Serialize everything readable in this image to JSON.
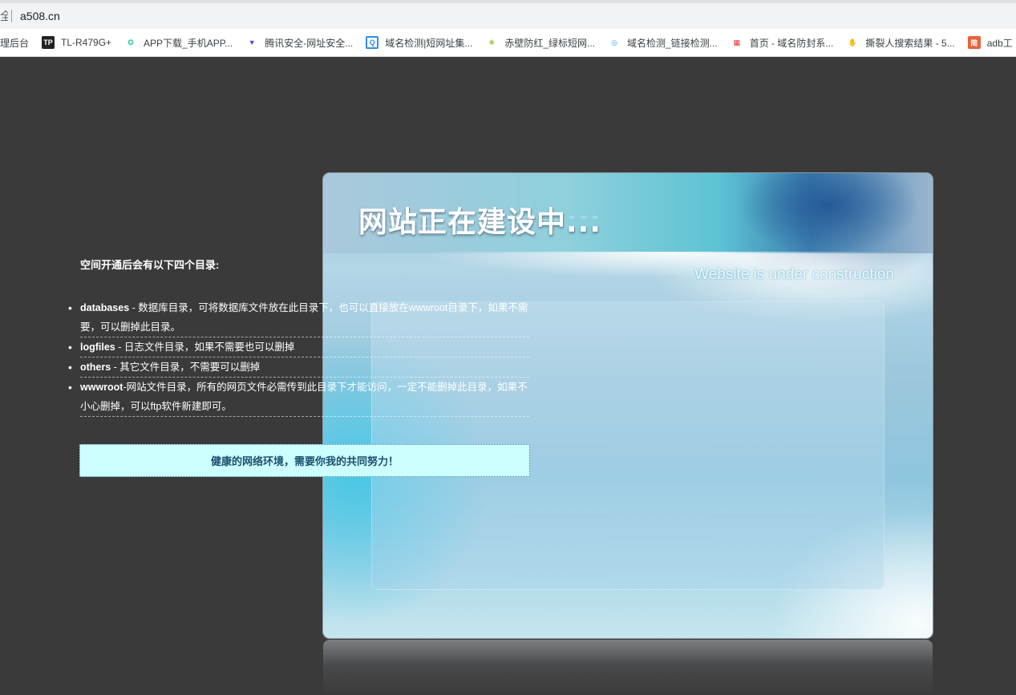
{
  "browser": {
    "address_prefix": "全",
    "url": "a508.cn"
  },
  "bookmarks": [
    {
      "label": "理后台",
      "icon": "none"
    },
    {
      "label": "TL-R479G+",
      "icon": "tp-link-icon",
      "glyph": "TP"
    },
    {
      "label": "APP下载_手机APP...",
      "icon": "app-download-icon",
      "glyph": "⬤"
    },
    {
      "label": "腾讯安全-网址安全...",
      "icon": "shield-icon",
      "glyph": "▼"
    },
    {
      "label": "域名检测|短网址集...",
      "icon": "q-logo-icon",
      "glyph": "Q"
    },
    {
      "label": "赤壁防红_绿标短网...",
      "icon": "spinner-icon",
      "glyph": "✺"
    },
    {
      "label": "域名检测_链接检测...",
      "icon": "search-icon",
      "glyph": "◎"
    },
    {
      "label": "首页 - 域名防封系...",
      "icon": "grid-icon",
      "glyph": "▦"
    },
    {
      "label": "撕裂人搜索结果 - 5...",
      "icon": "hand-icon",
      "glyph": "✋"
    },
    {
      "label": "adb工",
      "icon": "jian-icon",
      "glyph": "简"
    }
  ],
  "page": {
    "title_cn": "网站正在建设中...",
    "subtitle_en": "Website is under construction",
    "intro": "空间开通后会有以下四个目录:",
    "directories": [
      {
        "name": "databases",
        "desc": " - 数据库目录，可将数据库文件放在此目录下，也可以直接放在wwwroot目录下，如果不需要，可以删掉此目录。"
      },
      {
        "name": "logfiles",
        "desc": " - 日志文件目录，如果不需要也可以删掉"
      },
      {
        "name": "others",
        "desc": " - 其它文件目录，不需要可以删掉"
      },
      {
        "name": "wwwroot",
        "desc": "-网站文件目录，所有的网页文件必需传到此目录下才能访问，一定不能删掉此目录，如果不小心删掉，可以ftp软件新建即可。"
      }
    ],
    "footer_note": "健康的网络环境，需要你我的共同努力！"
  }
}
